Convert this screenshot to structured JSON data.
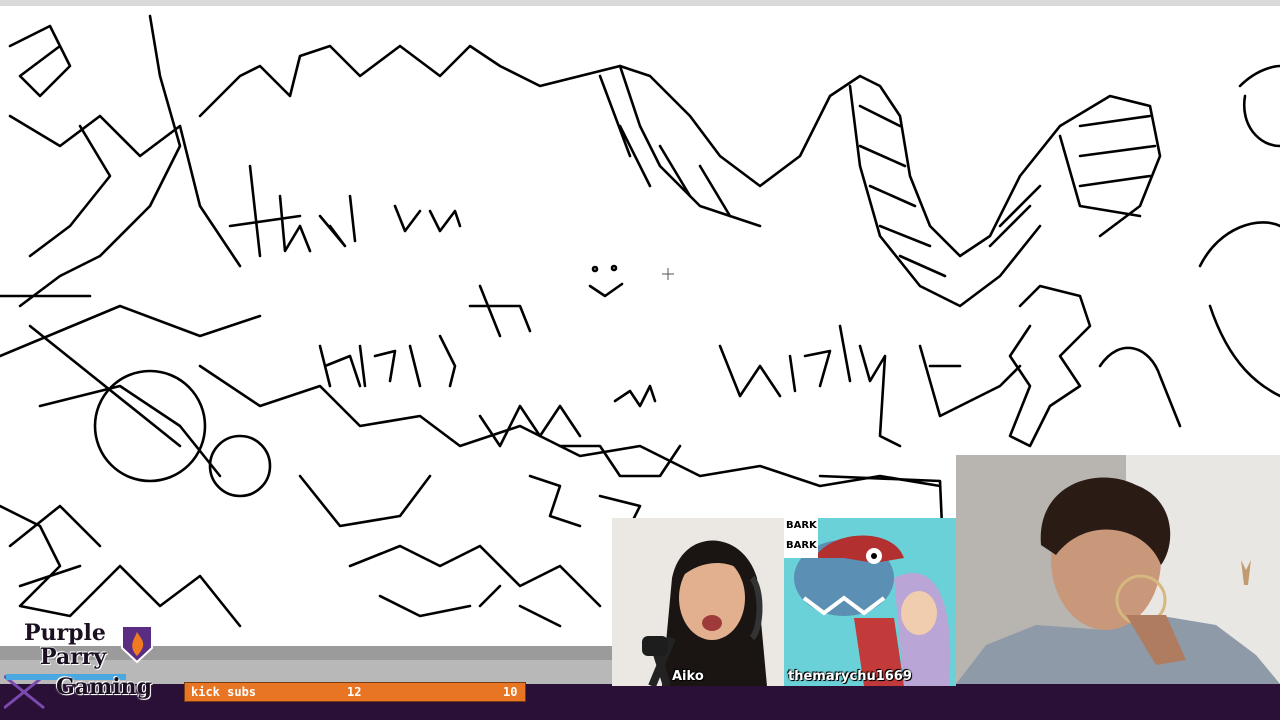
{
  "drawing": {
    "messages": [
      "thank you",
      "Hariet Tor",
      "and",
      "Witchery"
    ],
    "bark_text": [
      "BARK",
      "BARK"
    ]
  },
  "overlay": {
    "logo_lines": [
      "Purple",
      "Parry",
      "Gaming"
    ],
    "goal_label": "kick subs",
    "goal_current": "12",
    "goal_target": "10",
    "goal_progress": 1.0
  },
  "cameras": [
    {
      "name": "Aiko"
    },
    {
      "name": "themarychu1669"
    },
    {
      "name": ""
    }
  ],
  "colors": {
    "goal_bar": "#e87524",
    "bottom_bar": "#2a1036",
    "mary_background": "#6ad1d8"
  }
}
